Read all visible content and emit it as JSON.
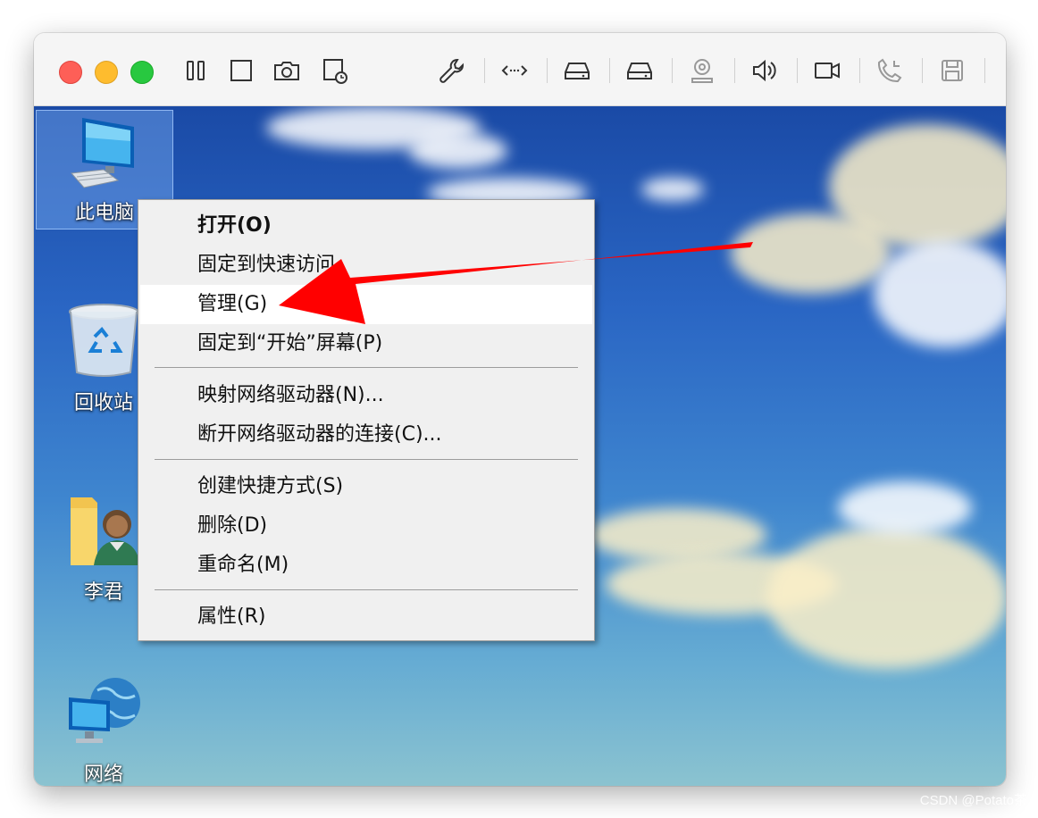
{
  "toolbar": {
    "icons": [
      "pause-icon",
      "stop-icon",
      "camera-icon",
      "snapshot-icon",
      "wrench-icon",
      "ports-icon",
      "disk-icon",
      "disk2-icon",
      "usb-icon",
      "speaker-icon",
      "video-icon",
      "phone-icon",
      "save-icon"
    ]
  },
  "desktop": {
    "icons": [
      {
        "label": "此电脑"
      },
      {
        "label": "回收站"
      },
      {
        "label": "李君"
      },
      {
        "label": "网络"
      }
    ]
  },
  "context_menu": {
    "items": [
      {
        "label": "打开(O)"
      },
      {
        "label": "固定到快速访问"
      },
      {
        "label": "管理(G)"
      },
      {
        "label": "固定到“开始”屏幕(P)"
      },
      {
        "label": "映射网络驱动器(N)..."
      },
      {
        "label": "断开网络驱动器的连接(C)..."
      },
      {
        "label": "创建快捷方式(S)"
      },
      {
        "label": "删除(D)"
      },
      {
        "label": "重命名(M)"
      },
      {
        "label": "属性(R)"
      }
    ]
  },
  "annotation": {
    "arrow_color": "#ff0000"
  },
  "watermark": "CSDN @Potato茶"
}
